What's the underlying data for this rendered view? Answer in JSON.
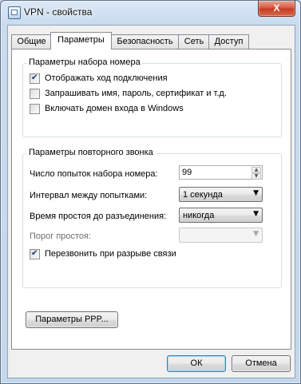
{
  "window": {
    "title": "VPN - свойства",
    "close_glyph": "X"
  },
  "tabs": [
    {
      "label": "Общие",
      "active": false
    },
    {
      "label": "Параметры",
      "active": true
    },
    {
      "label": "Безопасность",
      "active": false
    },
    {
      "label": "Сеть",
      "active": false
    },
    {
      "label": "Доступ",
      "active": false
    }
  ],
  "dial_group": {
    "title": "Параметры набора номера",
    "options": [
      {
        "label": "Отображать ход подключения",
        "checked": true
      },
      {
        "label": "Запрашивать имя, пароль, сертификат и т.д.",
        "checked": false
      },
      {
        "label": "Включать домен входа в Windows",
        "checked": false
      }
    ]
  },
  "redial_group": {
    "title": "Параметры повторного звонка",
    "attempts_label": "Число попыток набора номера:",
    "attempts_value": "99",
    "interval_label": "Интервал между попытками:",
    "interval_value": "1 секунда",
    "idle_label": "Время простоя до разъединения:",
    "idle_value": "никогда",
    "threshold_label": "Порог простоя:",
    "threshold_value": "",
    "redial_checkbox_label": "Перезвонить при разрыве связи",
    "redial_checked": true
  },
  "ppp_button": "Параметры PPP...",
  "footer": {
    "ok": "ОК",
    "cancel": "Отмена"
  }
}
